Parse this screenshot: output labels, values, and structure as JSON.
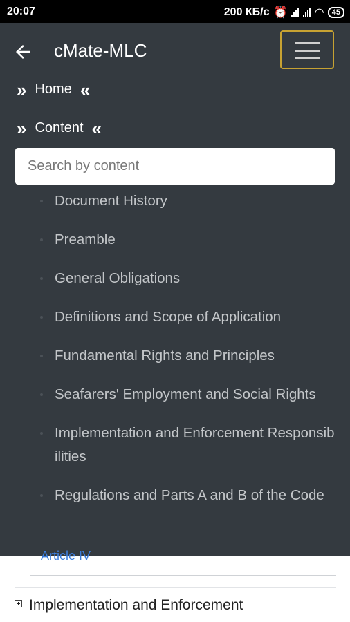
{
  "statusbar": {
    "time": "20:07",
    "speed": "200 КБ/с",
    "battery": "45"
  },
  "topbar": {
    "title": "cMate-MLC"
  },
  "nav": {
    "home": "Home",
    "content": "Content"
  },
  "search": {
    "placeholder": "Search by content"
  },
  "content_items": [
    "Document History",
    "Preamble",
    "General Obligations",
    "Definitions and Scope of Application",
    "Fundamental Rights and Principles",
    "Seafarers' Employment and Social Rights",
    "Implementation and Enforcement Responsibilities",
    "Regulations and Parts A and B of the Code"
  ],
  "below": {
    "article_link": "Article IV",
    "section_title": "Implementation and Enforcement"
  },
  "colors": {
    "drawer_bg": "#343a40",
    "accent_border": "#c7a232",
    "link": "#3b7ddd"
  }
}
